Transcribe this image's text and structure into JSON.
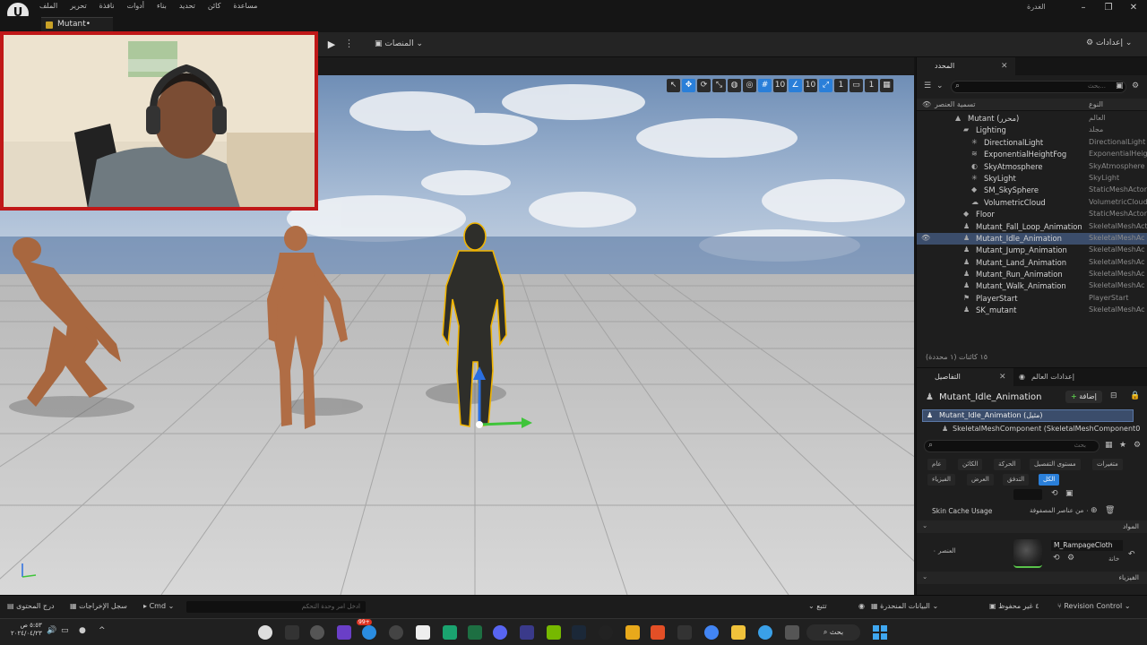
{
  "menu": {
    "items": [
      "الملف",
      "تحرير",
      "نافذة",
      "أدوات",
      "بناء",
      "تحديد",
      "كائن",
      "مساعدة"
    ],
    "project_name": "الغدرة"
  },
  "level_tab": {
    "label": "Mutant•"
  },
  "toolbar": {
    "platforms_label": "المنصات",
    "settings_label": "إعدادات"
  },
  "outliner": {
    "tab_label": "المحدد",
    "search_placeholder": "بحث...",
    "col_label": "تسمية العنصر",
    "col_type": "النوع",
    "rows": [
      {
        "label": "Mutant (محرر)",
        "type": "العالم",
        "depth": 1,
        "icon": "world-icon"
      },
      {
        "label": "Lighting",
        "type": "مجلد",
        "depth": 2,
        "icon": "folder-icon"
      },
      {
        "label": "DirectionalLight",
        "type": "DirectionalLight",
        "depth": 3,
        "icon": "light-icon"
      },
      {
        "label": "ExponentialHeightFog",
        "type": "ExponentialHeig",
        "depth": 3,
        "icon": "fog-icon"
      },
      {
        "label": "SkyAtmosphere",
        "type": "SkyAtmosphere",
        "depth": 3,
        "icon": "sky-icon"
      },
      {
        "label": "SkyLight",
        "type": "SkyLight",
        "depth": 3,
        "icon": "light-icon"
      },
      {
        "label": "SM_SkySphere",
        "type": "StaticMeshActor",
        "depth": 3,
        "icon": "mesh-icon"
      },
      {
        "label": "VolumetricCloud",
        "type": "VolumetricCloud",
        "depth": 3,
        "icon": "cloud-icon"
      },
      {
        "label": "Floor",
        "type": "StaticMeshActor",
        "depth": 2,
        "icon": "mesh-icon"
      },
      {
        "label": "Mutant_Fall_Loop_Animation",
        "type": "SkeletalMeshAct",
        "depth": 2,
        "icon": "skeletal-icon"
      },
      {
        "label": "Mutant_Idle_Animation",
        "type": "SkeletalMeshAc",
        "depth": 2,
        "icon": "skeletal-icon",
        "selected": true
      },
      {
        "label": "Mutant_Jump_Animation",
        "type": "SkeletalMeshAc",
        "depth": 2,
        "icon": "skeletal-icon"
      },
      {
        "label": "Mutant_Land_Animation",
        "type": "SkeletalMeshAc",
        "depth": 2,
        "icon": "skeletal-icon"
      },
      {
        "label": "Mutant_Run_Animation",
        "type": "SkeletalMeshAc",
        "depth": 2,
        "icon": "skeletal-icon"
      },
      {
        "label": "Mutant_Walk_Animation",
        "type": "SkeletalMeshAc",
        "depth": 2,
        "icon": "skeletal-icon"
      },
      {
        "label": "PlayerStart",
        "type": "PlayerStart",
        "depth": 2,
        "icon": "player-start-icon"
      },
      {
        "label": "SK_mutant",
        "type": "SkeletalMeshAc",
        "depth": 2,
        "icon": "skeletal-icon"
      }
    ],
    "count_label": "١٥ كائنات (١ محددة)"
  },
  "details": {
    "tab_label": "التفاصيل",
    "world_tab_label": "إعدادات العالم",
    "actor_name": "Mutant_Idle_Animation",
    "add_label": "إضافة",
    "component_root": "Mutant_Idle_Animation (مثيل)",
    "component_child": "SkeletalMeshComponent (SkeletalMeshComponent0",
    "search_placeholder": "بحث",
    "filters_row1": [
      "متغيرات",
      "مستوى التفصيل",
      "الحركة",
      "الكائن",
      "عام"
    ],
    "filters_row2": [
      "الكل",
      "التدفق",
      "العرض",
      "الفيزياء"
    ],
    "active_filter": "الكل",
    "skin_cache_label": "Skin Cache Usage",
    "skin_cache_value": "٠ من عناصر المصفوفة",
    "materials_section": "المواد",
    "material_element_label": "العنصر ٠",
    "material_name": "M_RampageCloth",
    "material_slot_label": "خانة",
    "physics_section": "الفيزياء"
  },
  "statusbar": {
    "content_drawer": "درج المحتوى",
    "output_log": "سجل الإخراجات",
    "cmd_label": "Cmd",
    "cmd_placeholder": "ادخل امر وحدة التحكم",
    "trace_label": "تتبع",
    "derived_data": "البيانات المنحدرة",
    "unsaved": "٤ غير محفوظ",
    "revision_control": "Revision Control"
  },
  "taskbar": {
    "search_label": "بحث",
    "time": "٥:٥٣ ص",
    "date": "٢٠٢٤/٠٤/٢٣",
    "badge": "99+"
  },
  "colors": {
    "accent": "#2a7fd9",
    "selection": "#3b4d6b",
    "webcam_border": "#c01818",
    "add_green": "#59c24a"
  }
}
